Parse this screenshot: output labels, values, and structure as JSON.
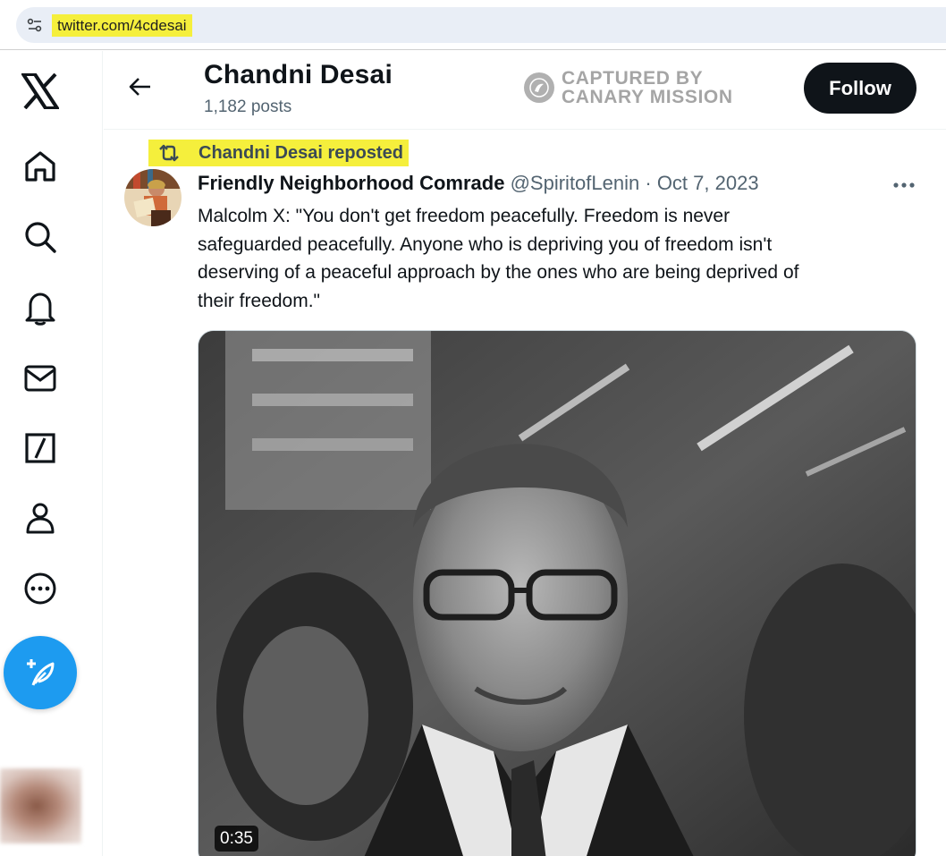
{
  "browser": {
    "url": "twitter.com/4cdesai",
    "highlight_color": "#f5ef3c"
  },
  "sidebar": {
    "items": [
      {
        "icon": "x-logo-icon"
      },
      {
        "icon": "home-icon"
      },
      {
        "icon": "search-icon"
      },
      {
        "icon": "bell-icon"
      },
      {
        "icon": "mail-icon"
      },
      {
        "icon": "grok-icon"
      },
      {
        "icon": "profile-icon"
      },
      {
        "icon": "more-circle-icon"
      }
    ],
    "compose_icon": "feather-plus-icon",
    "accent_color": "#1d9bf0"
  },
  "header": {
    "profile_name": "Chandni Desai",
    "post_count": "1,182 posts",
    "follow_label": "Follow"
  },
  "watermark": {
    "line1": "CAPTURED BY",
    "line2": "CANARY MISSION"
  },
  "post": {
    "repost_label": "Chandni Desai reposted",
    "author_name": "Friendly Neighborhood Comrade",
    "author_handle": "@SpiritofLenin",
    "separator": "·",
    "date": "Oct 7, 2023",
    "text": "Malcolm X: \"You don't get freedom peacefully. Freedom is never\nsafeguarded peacefully. Anyone who is depriving you of freedom isn't\ndeserving of a peaceful approach by the ones who are being deprived of\ntheir freedom.\"",
    "video_duration": "0:35"
  }
}
